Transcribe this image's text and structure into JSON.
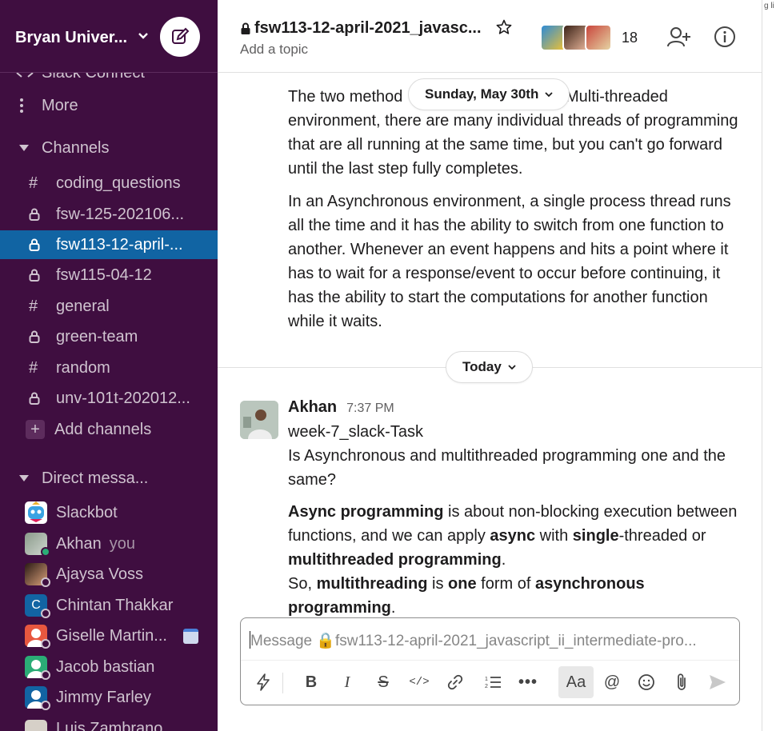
{
  "workspace": {
    "name": "Bryan Univer..."
  },
  "sidebar": {
    "partial_item": "Slack Connect",
    "more_label": "More",
    "channels_header": "Channels",
    "channels": [
      {
        "label": "coding_questions",
        "icon": "hash"
      },
      {
        "label": "fsw-125-202106...",
        "icon": "lock"
      },
      {
        "label": "fsw113-12-april-...",
        "icon": "lock",
        "active": true
      },
      {
        "label": "fsw115-04-12",
        "icon": "lock"
      },
      {
        "label": "general",
        "icon": "hash"
      },
      {
        "label": "green-team",
        "icon": "lock"
      },
      {
        "label": "random",
        "icon": "hash"
      },
      {
        "label": "unv-101t-202012...",
        "icon": "lock"
      }
    ],
    "add_channels": "Add channels",
    "dm_header": "Direct messa...",
    "dms": [
      {
        "label": "Slackbot"
      },
      {
        "label": "Akhan",
        "suffix": "you"
      },
      {
        "label": "Ajaysa Voss"
      },
      {
        "label": "Chintan Thakkar"
      },
      {
        "label": "Giselle Martin..."
      },
      {
        "label": "Jacob bastian"
      },
      {
        "label": "Jimmy Farley"
      },
      {
        "label": "Luis Zambrano"
      }
    ]
  },
  "header": {
    "channel_name": "fsw113-12-april-2021_javasc...",
    "topic": "Add a topic",
    "member_count": "18"
  },
  "messages": {
    "prev_paragraph_1": "The two method",
    "prev_paragraph_1_rest": " Multi-threaded environment, there are many individual threads of programming that are all running at the same time, but you can't go forward until the last step fully completes.",
    "prev_paragraph_2": "In an Asynchronous environment, a single process thread runs all the time and it has the ability to switch from one function to another. Whenever an event happens and hits a point where it has to wait for a response/event to occur before continuing, it has the ability to start the computations for another function while it waits.",
    "date_pill_1": "Sunday, May 30th",
    "date_pill_2": "Today",
    "author": "Akhan",
    "time": "7:37 PM",
    "line_1": "week-7_slack-Task",
    "line_2": "Is Asynchronous and multithreaded programming one and the same?",
    "answer": {
      "p1_b1": "Async programming",
      "p1_t1": " is about non-blocking execution between functions, and we can apply ",
      "p1_b2": "async",
      "p1_t2": " with ",
      "p1_b3": "single",
      "p1_t3": "-threaded or ",
      "p1_b4": "multithreaded programming",
      "p1_t4": ".",
      "p2_t1": "So, ",
      "p2_b1": "multithreading",
      "p2_t2": " is ",
      "p2_b2": "one",
      "p2_t3": " form of ",
      "p2_b3": "asynchronous programming",
      "p2_t4": "."
    }
  },
  "composer": {
    "placeholder": "Message 🔒fsw113-12-april-2021_javascript_ii_intermediate-pro..."
  },
  "right_strip_text": "g li",
  "colors": {
    "sidebar": "#3f0e40",
    "active": "#1164a3"
  }
}
